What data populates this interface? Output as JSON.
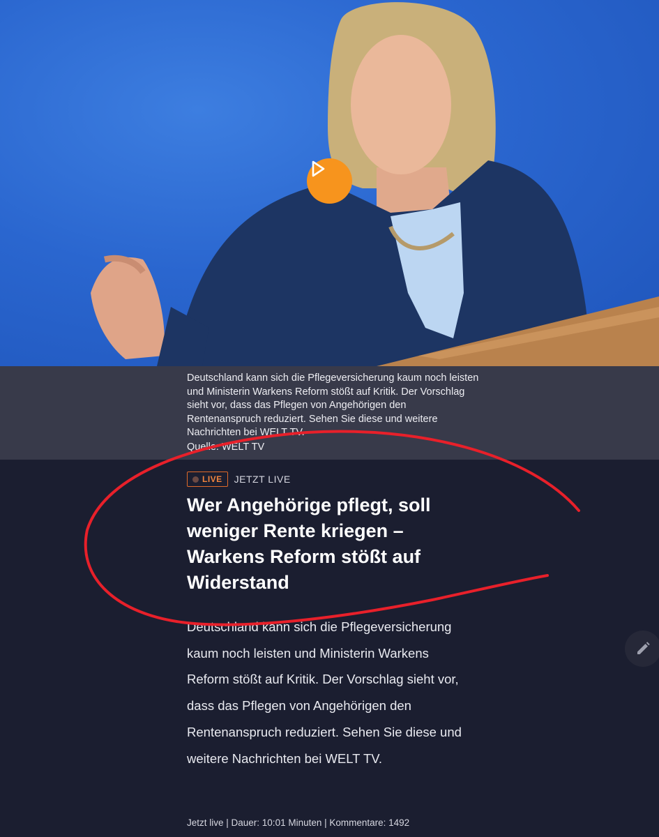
{
  "video": {
    "play_icon": "play-icon"
  },
  "caption": {
    "text": "Deutschland kann sich die Pflegeversicherung kaum noch leisten und Ministerin Warkens Reform stößt auf Kritik. Der Vorschlag sieht vor, dass das Pflegen von Angehörigen den Rentenanspruch reduziert. Sehen Sie diese und weitere Nachrichten bei WELT TV.",
    "source": "Quelle: WELT TV"
  },
  "article": {
    "live_badge": "LIVE",
    "live_status": "JETZT LIVE",
    "headline": "Wer Angehörige pflegt, soll weniger Rente kriegen – Warkens Reform stößt auf Widerstand",
    "body": "Deutschland kann sich die Pflegeversicherung kaum noch leisten und Ministerin Warkens Reform stößt auf Kritik. Der Vorschlag sieht vor, dass das Pflegen von Angehörigen den Rentenanspruch reduziert. Sehen Sie diese und weitere Nachrichten bei WELT TV.",
    "meta": "Jetzt live | Dauer: 10:01 Minuten | Kommentare: 1492"
  },
  "colors": {
    "background": "#1b1e30",
    "accent_orange": "#f7941d",
    "annotation_red": "#e8202a",
    "caption_band": "#383a4a"
  },
  "edit": {
    "icon": "pencil-icon"
  }
}
